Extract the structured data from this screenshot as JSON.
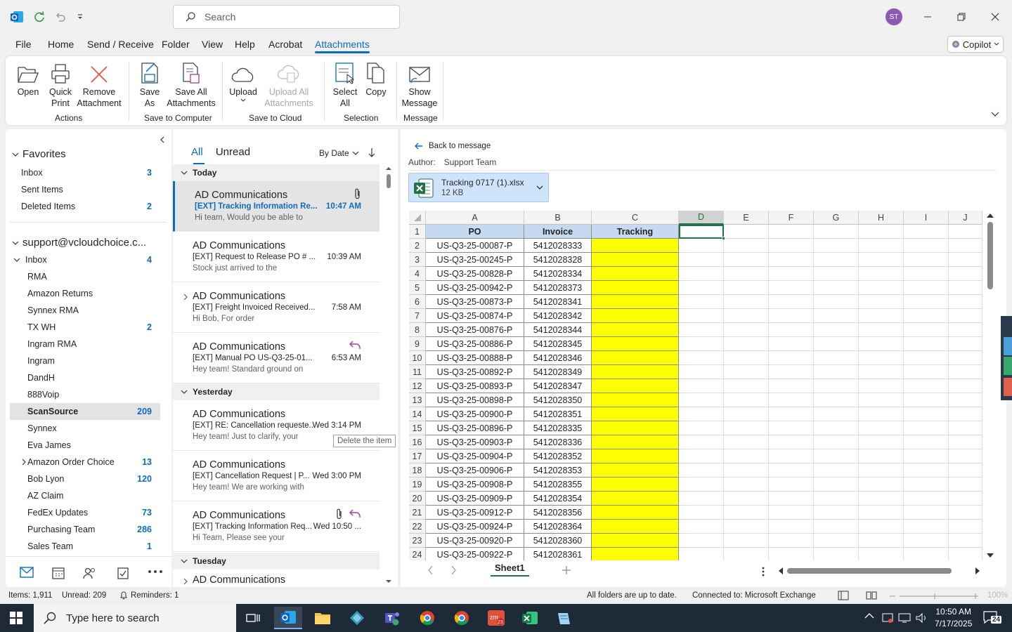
{
  "titlebar": {
    "search_placeholder": "Search",
    "avatar_initials": "ST"
  },
  "menu": {
    "tabs": [
      "File",
      "Home",
      "Send / Receive",
      "Folder",
      "View",
      "Help",
      "Acrobat",
      "Attachments"
    ],
    "active": "Attachments",
    "copilot": "Copilot"
  },
  "ribbon": {
    "open": "Open",
    "quick_print": [
      "Quick",
      "Print"
    ],
    "remove_attachment": [
      "Remove",
      "Attachment"
    ],
    "save_as": [
      "Save",
      "As"
    ],
    "save_all": [
      "Save All",
      "Attachments"
    ],
    "upload": "Upload",
    "upload_all": [
      "Upload All",
      "Attachments"
    ],
    "select_all": [
      "Select",
      "All"
    ],
    "copy": "Copy",
    "show_message": [
      "Show",
      "Message"
    ],
    "groups": {
      "actions": "Actions",
      "save_to_computer": "Save to Computer",
      "save_to_cloud": "Save to Cloud",
      "selection": "Selection",
      "message": "Message"
    }
  },
  "folders": {
    "favorites_label": "Favorites",
    "favorites": [
      {
        "name": "Inbox",
        "count": "3"
      },
      {
        "name": "Sent Items",
        "count": ""
      },
      {
        "name": "Deleted Items",
        "count": "2"
      }
    ],
    "account": "support@vcloudchoice.c...",
    "inbox_label": "Inbox",
    "inbox_count": "4",
    "subfolders": [
      {
        "name": "RMA",
        "count": ""
      },
      {
        "name": "Amazon Returns",
        "count": ""
      },
      {
        "name": "Synnex RMA",
        "count": ""
      },
      {
        "name": "TX WH",
        "count": "2"
      },
      {
        "name": "Ingram RMA",
        "count": ""
      },
      {
        "name": "Ingram",
        "count": ""
      },
      {
        "name": "DandH",
        "count": ""
      },
      {
        "name": "888Voip",
        "count": ""
      },
      {
        "name": "ScanSource",
        "count": "209"
      },
      {
        "name": "Synnex",
        "count": ""
      },
      {
        "name": "Eva James",
        "count": ""
      },
      {
        "name": "Amazon Order Choice",
        "count": "13"
      },
      {
        "name": "Bob Lyon",
        "count": "120"
      },
      {
        "name": "AZ Claim",
        "count": ""
      },
      {
        "name": "FedEx Updates",
        "count": "73"
      },
      {
        "name": "Purchasing Team",
        "count": "286"
      },
      {
        "name": "Sales Team",
        "count": "1"
      }
    ],
    "selected": "ScanSource"
  },
  "messages": {
    "tab_all": "All",
    "tab_unread": "Unread",
    "sort": "By Date",
    "groups": {
      "today": "Today",
      "yesterday": "Yesterday",
      "tuesday": "Tuesday"
    },
    "items": [
      {
        "from": "AD Communications",
        "subject": "[EXT] Tracking Information Re...",
        "time": "10:47 AM",
        "preview": "Hi team,  Would you be able to"
      },
      {
        "from": "AD Communications",
        "subject": "[EXT] Request to Release PO # ...",
        "time": "10:39 AM",
        "preview": "Stock just arrived to the"
      },
      {
        "from": "AD Communications",
        "subject": "[EXT] Freight Invoiced Received...",
        "time": "7:58 AM",
        "preview": "Hi Bob,  For order"
      },
      {
        "from": "AD Communications",
        "subject": "[EXT] Manual PO   US-Q3-25-01...",
        "time": "6:53 AM",
        "preview": "Hey team!  Standard ground on"
      },
      {
        "from": "AD Communications",
        "subject": "[EXT] RE: Cancellation requeste...",
        "time": "Wed 3:14 PM",
        "preview": "Hey team!  Just to clarify, your"
      },
      {
        "from": "AD Communications",
        "subject": "[EXT] Cancellation Request | P...",
        "time": "Wed 3:00 PM",
        "preview": "Hey team!  We are working with"
      },
      {
        "from": "AD Communications",
        "subject": "[EXT] Tracking Information Req...",
        "time": "Wed 10:50 ...",
        "preview": "Hi Team,   Please see your"
      },
      {
        "from": "AD Communications",
        "subject": "",
        "time": "",
        "preview": ""
      }
    ],
    "tooltip": "Delete the item"
  },
  "reading": {
    "back": "Back to message",
    "author_label": "Author:",
    "author": "Support Team",
    "attachment_name": "Tracking 0717 (1).xlsx",
    "attachment_size": "12 KB"
  },
  "sheet": {
    "columns": [
      "A",
      "B",
      "C",
      "D",
      "E",
      "F",
      "G",
      "H",
      "I",
      "J"
    ],
    "headers": [
      "PO",
      "Invoice",
      "Tracking"
    ],
    "rows": [
      [
        "US-Q3-25-00087-P",
        "5412028333"
      ],
      [
        "US-Q3-25-00245-P",
        "5412028328"
      ],
      [
        "US-Q3-25-00828-P",
        "5412028334"
      ],
      [
        "US-Q3-25-00942-P",
        "5412028373"
      ],
      [
        "US-Q3-25-00873-P",
        "5412028341"
      ],
      [
        "US-Q3-25-00874-P",
        "5412028342"
      ],
      [
        "US-Q3-25-00876-P",
        "5412028344"
      ],
      [
        "US-Q3-25-00886-P",
        "5412028345"
      ],
      [
        "US-Q3-25-00888-P",
        "5412028346"
      ],
      [
        "US-Q3-25-00892-P",
        "5412028349"
      ],
      [
        "US-Q3-25-00893-P",
        "5412028347"
      ],
      [
        "US-Q3-25-00898-P",
        "5412028350"
      ],
      [
        "US-Q3-25-00900-P",
        "5412028351"
      ],
      [
        "US-Q3-25-00896-P",
        "5412028335"
      ],
      [
        "US-Q3-25-00903-P",
        "5412028336"
      ],
      [
        "US-Q3-25-00904-P",
        "5412028352"
      ],
      [
        "US-Q3-25-00906-P",
        "5412028353"
      ],
      [
        "US-Q3-25-00908-P",
        "5412028355"
      ],
      [
        "US-Q3-25-00909-P",
        "5412028354"
      ],
      [
        "US-Q3-25-00912-P",
        "5412028356"
      ],
      [
        "US-Q3-25-00924-P",
        "5412028364"
      ],
      [
        "US-Q3-25-00920-P",
        "5412028360"
      ],
      [
        "US-Q3-25-00922-P",
        "5412028361"
      ]
    ],
    "tab_name": "Sheet1",
    "tracking_fill": "#ffff00",
    "header_fill": "#c5d9f1"
  },
  "status": {
    "items": "Items: 1,911",
    "unread": "Unread: 209",
    "reminders": "Reminders: 1",
    "sync": "All folders are up to date.",
    "connection": "Connected to: Microsoft Exchange",
    "zoom": "100%"
  },
  "taskbar": {
    "search_placeholder": "Type here to search",
    "time": "10:50 AM",
    "date": "7/17/2025",
    "notifications": "24"
  }
}
